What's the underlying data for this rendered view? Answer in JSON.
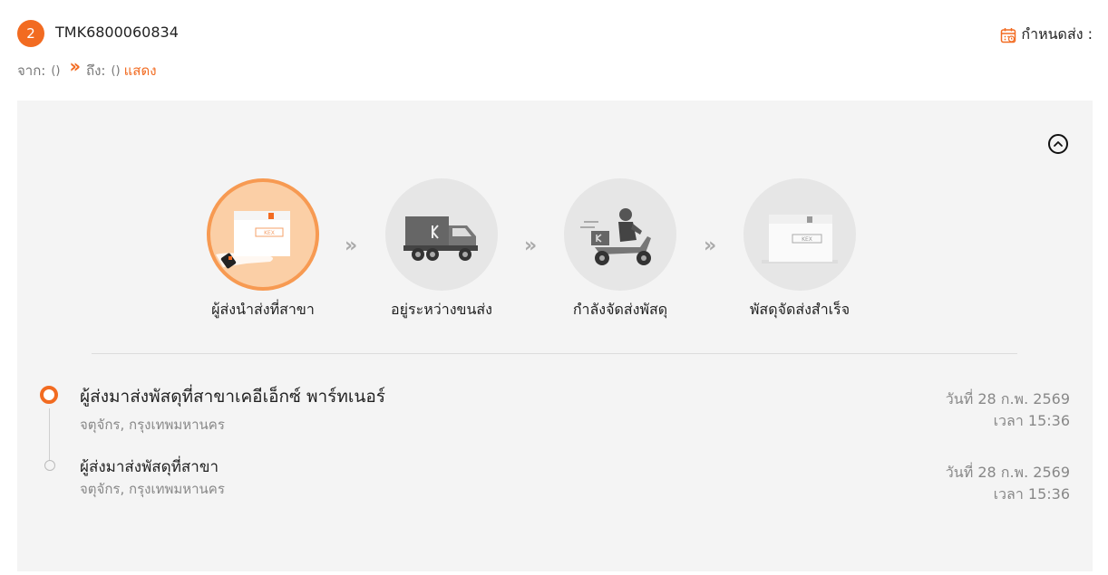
{
  "header": {
    "badge": "2",
    "tracking_number": "TMK6800060834",
    "due_label": "กำหนดส่ง :",
    "due_icon": "calendar-icon"
  },
  "route": {
    "from_label": "จาก:",
    "from_value": "()",
    "to_label": "ถึง:",
    "to_value": "()",
    "show_link": "แสดง"
  },
  "steps": [
    {
      "label": "ผู้ส่งนำส่งที่สาขา",
      "icon": "parcel-hand-icon",
      "active": true
    },
    {
      "label": "อยู่ระหว่างขนส่ง",
      "icon": "truck-icon",
      "active": false
    },
    {
      "label": "กำลังจัดส่งพัสดุ",
      "icon": "scooter-courier-icon",
      "active": false
    },
    {
      "label": "พัสดุจัดส่งสำเร็จ",
      "icon": "delivered-box-icon",
      "active": false
    }
  ],
  "box_brand": "KEX",
  "events": [
    {
      "title": "ผู้ส่งมาส่งพัสดุที่สาขาเคอีเอ็กซ์ พาร์ทเนอร์",
      "location": "จตุจักร, กรุงเทพมหานคร",
      "date": "วันที่ 28 ก.พ. 2569",
      "time": "เวลา 15:36"
    },
    {
      "title": "ผู้ส่งมาส่งพัสดุที่สาขา",
      "location": "จตุจักร, กรุงเทพมหานคร",
      "date": "วันที่ 28 ก.พ. 2569",
      "time": "เวลา 15:36"
    }
  ],
  "colors": {
    "accent": "#f26b21",
    "panel": "#f4f4f4"
  }
}
